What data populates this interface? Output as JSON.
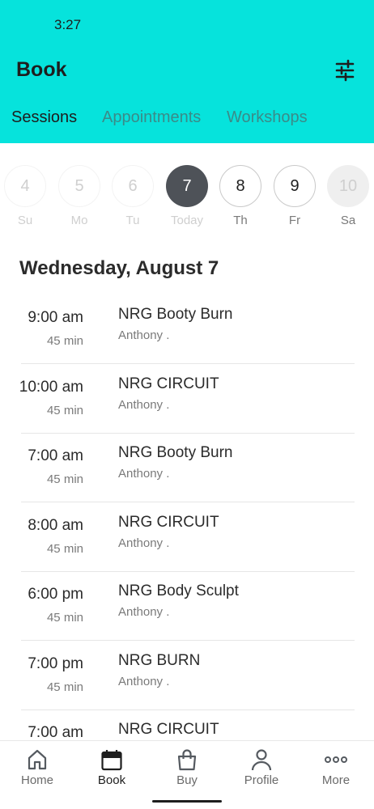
{
  "status_bar": {
    "time": "3:27"
  },
  "header": {
    "title": "Book",
    "filter_icon": "sliders-icon"
  },
  "tabs": [
    {
      "label": "Sessions",
      "active": true
    },
    {
      "label": "Appointments",
      "active": false
    },
    {
      "label": "Workshops",
      "active": false
    }
  ],
  "dates": [
    {
      "day": "4",
      "dow": "Su",
      "state": "past"
    },
    {
      "day": "5",
      "dow": "Mo",
      "state": "past"
    },
    {
      "day": "6",
      "dow": "Tu",
      "state": "past"
    },
    {
      "day": "7",
      "dow": "Today",
      "state": "today"
    },
    {
      "day": "8",
      "dow": "Th",
      "state": "future"
    },
    {
      "day": "9",
      "dow": "Fr",
      "state": "future"
    },
    {
      "day": "10",
      "dow": "Sa",
      "state": "disabled"
    }
  ],
  "day_heading": "Wednesday, August 7",
  "sessions": [
    {
      "time": "9:00 am",
      "duration": "45 min",
      "name": "NRG Booty Burn",
      "instructor": "Anthony ."
    },
    {
      "time": "10:00 am",
      "duration": "45 min",
      "name": "NRG CIRCUIT",
      "instructor": "Anthony ."
    },
    {
      "time": "7:00 am",
      "duration": "45 min",
      "name": "NRG Booty Burn",
      "instructor": "Anthony ."
    },
    {
      "time": "8:00 am",
      "duration": "45 min",
      "name": "NRG CIRCUIT",
      "instructor": "Anthony ."
    },
    {
      "time": "6:00 pm",
      "duration": "45 min",
      "name": "NRG Body Sculpt",
      "instructor": "Anthony ."
    },
    {
      "time": "7:00 pm",
      "duration": "45 min",
      "name": "NRG BURN",
      "instructor": "Anthony ."
    },
    {
      "time": "7:00 am",
      "duration": "",
      "name": "NRG CIRCUIT",
      "instructor": ""
    }
  ],
  "bottom_nav": [
    {
      "label": "Home",
      "icon": "home-icon",
      "active": false
    },
    {
      "label": "Book",
      "icon": "calendar-icon",
      "active": true
    },
    {
      "label": "Buy",
      "icon": "shopping-bag-icon",
      "active": false
    },
    {
      "label": "Profile",
      "icon": "person-icon",
      "active": false
    },
    {
      "label": "More",
      "icon": "more-dots-icon",
      "active": false
    }
  ],
  "colors": {
    "header_bg": "#06e3dc",
    "inactive_tab": "#3a8b88",
    "today_circle": "#4e5258"
  }
}
